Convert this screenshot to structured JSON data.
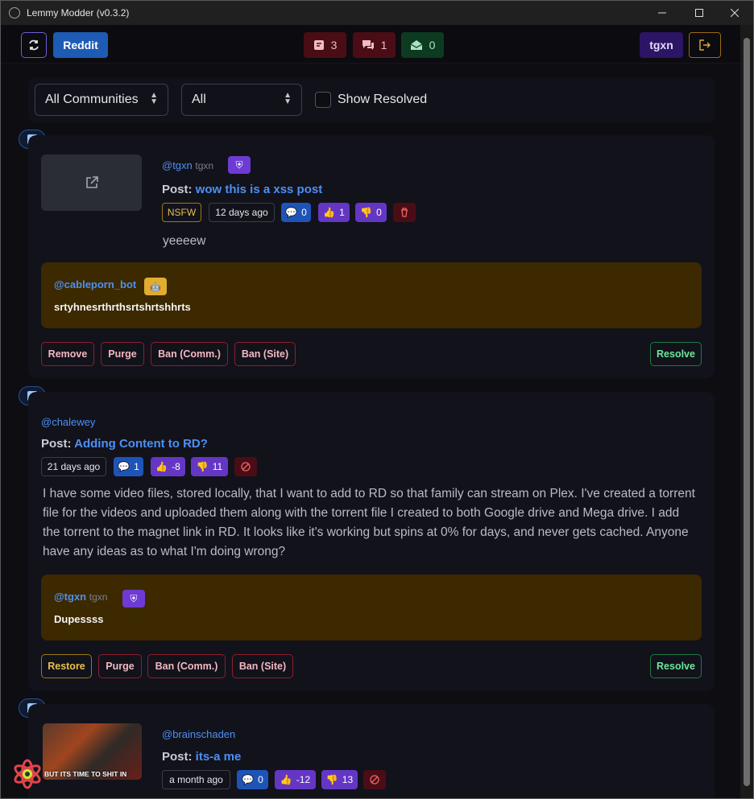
{
  "app": {
    "title": "Lemmy Modder (v0.3.2)"
  },
  "topbar": {
    "reddit_label": "Reddit",
    "counts": [
      {
        "icon": "report-icon",
        "value": "3"
      },
      {
        "icon": "comment-icon",
        "value": "1"
      },
      {
        "icon": "mail-icon",
        "value": "0"
      }
    ],
    "username": "tgxn"
  },
  "filters": {
    "community": "All Communities",
    "type": "All",
    "show_resolved_label": "Show Resolved"
  },
  "reports": [
    {
      "author": "@tgxn",
      "author_tag": "tgxn",
      "post_prefix": "Post:",
      "post_title": "wow this is a xss post",
      "nsfw": "NSFW",
      "date": "12 days ago",
      "comments": "0",
      "upvotes": "1",
      "downvotes": "0",
      "body": "yeeeew",
      "report_author": "@cableporn_bot",
      "report_text": "srtyhnesrthrthsrtshrtshhrts",
      "actions": [
        "Remove",
        "Purge",
        "Ban (Comm.)",
        "Ban (Site)"
      ],
      "resolve": "Resolve"
    },
    {
      "author": "@chalewey",
      "post_prefix": "Post:",
      "post_title": "Adding Content to RD?",
      "date": "21 days ago",
      "comments": "1",
      "upvotes": "-8",
      "downvotes": "11",
      "body": "I have some video files, stored locally, that I want to add to RD so that family can stream on Plex. I've created a torrent file for the videos and uploaded them along with the torrent file I created to both Google drive and Mega drive. I add the torrent to the magnet link in RD. It looks like it's working but spins at 0% for days, and never gets cached. Anyone have any ideas as to what I'm doing wrong?",
      "report_author": "@tgxn",
      "report_author_tag": "tgxn",
      "report_text": "Dupessss",
      "actions": [
        "Restore",
        "Purge",
        "Ban (Comm.)",
        "Ban (Site)"
      ],
      "resolve": "Resolve"
    },
    {
      "author": "@brainschaden",
      "post_prefix": "Post:",
      "post_title": "its-a me",
      "date": "a month ago",
      "comments": "0",
      "upvotes": "-12",
      "downvotes": "13",
      "image_caption": "BUT ITS TIME TO SHIT IN"
    }
  ]
}
